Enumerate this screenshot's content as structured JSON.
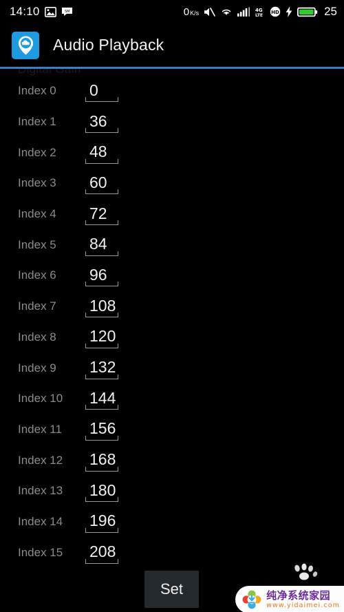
{
  "status_bar": {
    "time": "14:10",
    "left_icons": [
      "image-icon",
      "screenshot-icon"
    ],
    "network_speed": "0",
    "network_speed_unit": "K/s",
    "right_icons": [
      "mute-icon",
      "wifi-icon",
      "signal-bars-icon",
      "4g-lte-icon",
      "volte-hd-icon",
      "charging-bolt-icon",
      "battery-icon"
    ],
    "signal_label_top": "4G",
    "signal_label_bottom": "LTE",
    "volte_label": "HD",
    "battery_percent": "25",
    "battery_color": "#2ecc2e"
  },
  "title_bar": {
    "app_icon": "cloud-pin-icon",
    "app_icon_color": "#1e9ae0",
    "title": "Audio Playback"
  },
  "divider_color": "#3b7fc4",
  "content": {
    "section_label": "Digital Gain",
    "rows": [
      {
        "label": "Index 0",
        "value": "0"
      },
      {
        "label": "Index 1",
        "value": "36"
      },
      {
        "label": "Index 2",
        "value": "48"
      },
      {
        "label": "Index 3",
        "value": "60"
      },
      {
        "label": "Index 4",
        "value": "72"
      },
      {
        "label": "Index 5",
        "value": "84"
      },
      {
        "label": "Index 6",
        "value": "96"
      },
      {
        "label": "Index 7",
        "value": "108"
      },
      {
        "label": "Index 8",
        "value": "120"
      },
      {
        "label": "Index 9",
        "value": "132"
      },
      {
        "label": "Index 10",
        "value": "144"
      },
      {
        "label": "Index 11",
        "value": "156"
      },
      {
        "label": "Index 12",
        "value": "168"
      },
      {
        "label": "Index 13",
        "value": "180"
      },
      {
        "label": "Index 14",
        "value": "196"
      },
      {
        "label": "Index 15",
        "value": "208"
      }
    ]
  },
  "footer": {
    "set_button_label": "Set"
  },
  "watermark": {
    "paw_icon": "paw-print-icon",
    "logo_icon": "flower-download-logo-icon",
    "site_name": "纯净系统家园",
    "site_url": "www.yidaimei.com",
    "name_color": "#6a2c9c",
    "url_color": "#e8761a"
  }
}
